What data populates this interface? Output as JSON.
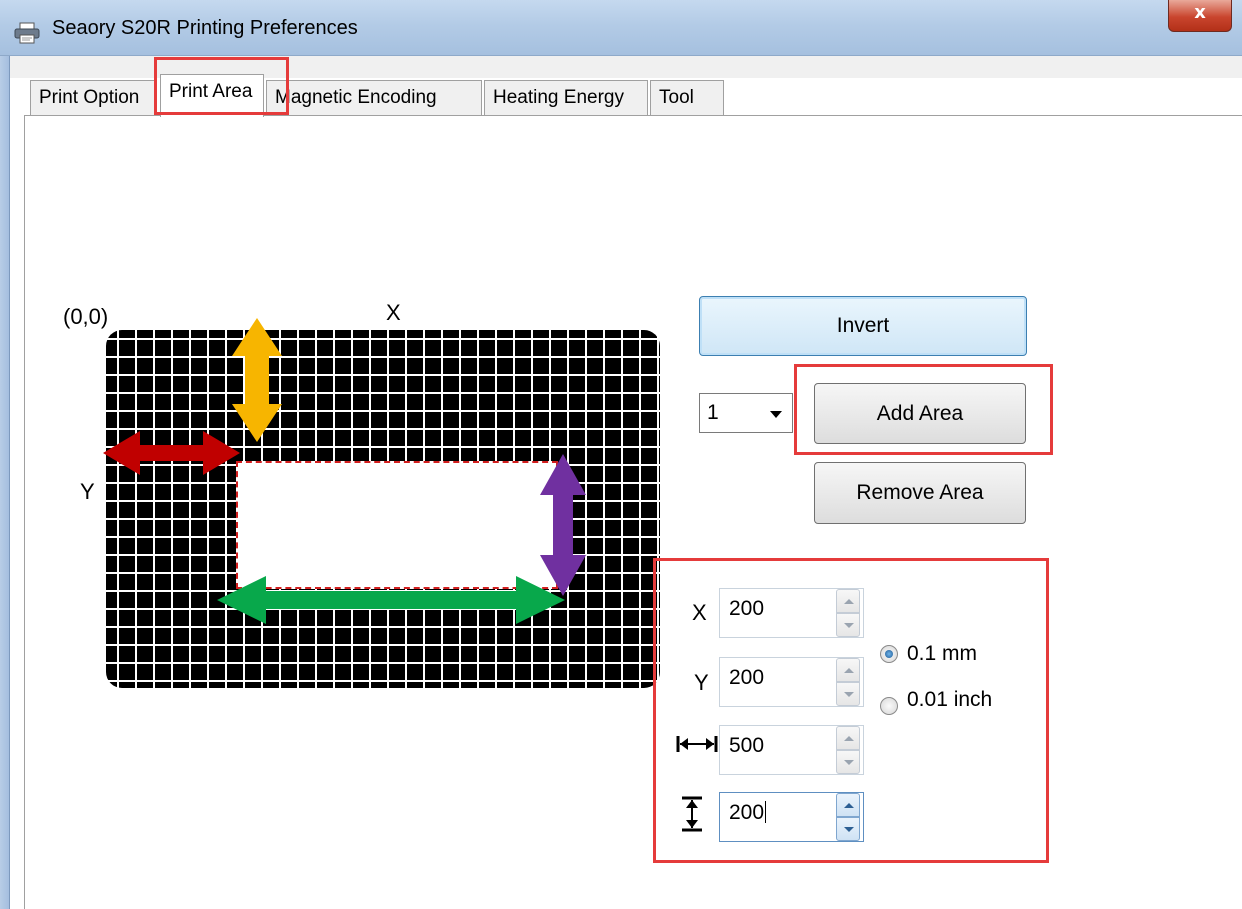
{
  "window": {
    "title": "Seaory S20R Printing Preferences",
    "close_label": "x"
  },
  "tabs": [
    {
      "label": "Print Option",
      "active": false
    },
    {
      "label": "Print Area",
      "active": true
    },
    {
      "label": "Magnetic Encoding",
      "active": false
    },
    {
      "label": "Heating Energy",
      "active": false
    },
    {
      "label": "Tool",
      "active": false
    }
  ],
  "diagram": {
    "origin_label": "(0,0)",
    "x_label": "X",
    "y_label": "Y"
  },
  "buttons": {
    "invert": "Invert",
    "add_area": "Add Area",
    "remove_area": "Remove Area"
  },
  "area_select": {
    "value": "1"
  },
  "fields": {
    "x": {
      "label": "X",
      "value": "200"
    },
    "y": {
      "label": "Y",
      "value": "200"
    },
    "width": {
      "icon": "width-icon",
      "value": "500"
    },
    "height": {
      "icon": "height-icon",
      "value": "200"
    }
  },
  "units": [
    {
      "label": "0.1 mm",
      "checked": true
    },
    {
      "label": "0.01 inch",
      "checked": false
    }
  ],
  "colors": {
    "highlight": "#e53b3b",
    "arrow_y_offset": "#f7b500",
    "arrow_x_offset": "#c00000",
    "arrow_width": "#08a84b",
    "arrow_height": "#7030a0",
    "print_area_border": "#d21f1f"
  }
}
